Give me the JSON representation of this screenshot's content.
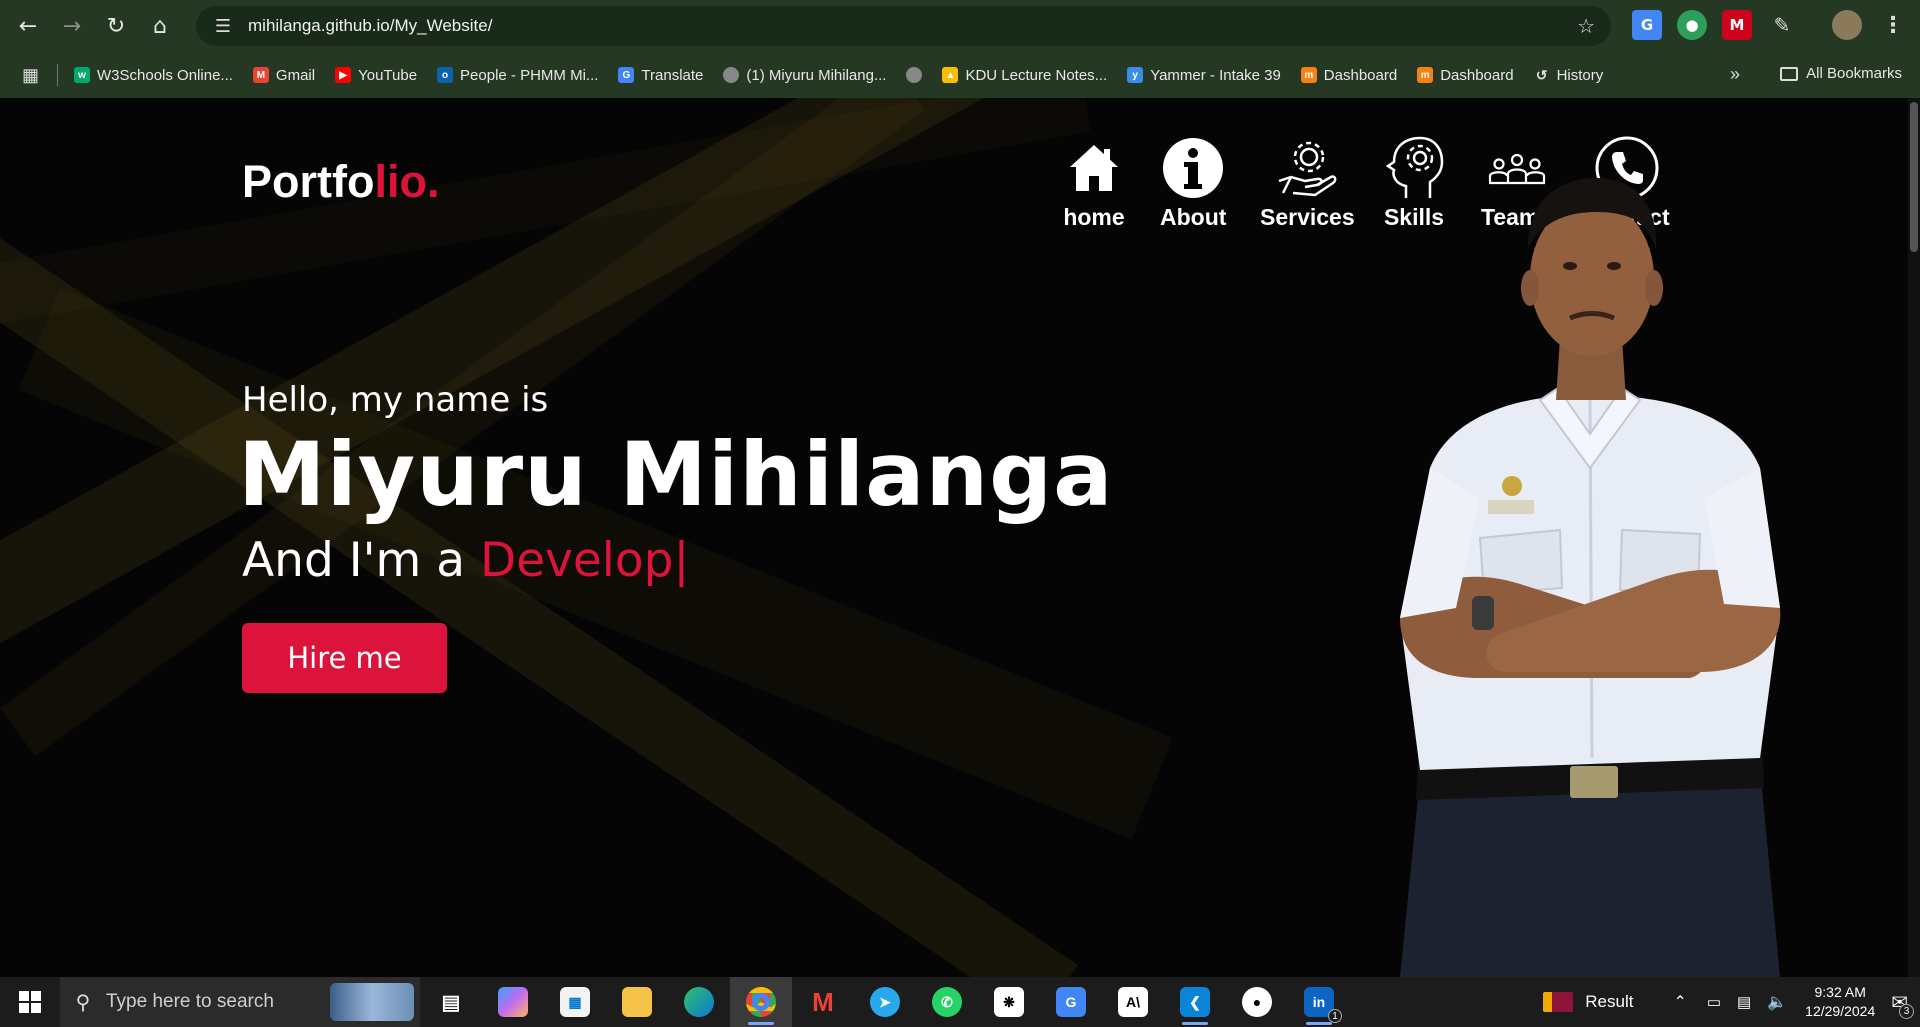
{
  "browser": {
    "url": "mihilanga.github.io/My_Website/",
    "bookmarks": [
      {
        "label": "W3Schools Online...",
        "icon": "w3schools-icon",
        "color": "#04aa6d"
      },
      {
        "label": "Gmail",
        "icon": "gmail-icon",
        "color": "#ea4335"
      },
      {
        "label": "YouTube",
        "icon": "youtube-icon",
        "color": "#ff0000"
      },
      {
        "label": "People - PHMM Mi...",
        "icon": "outlook-icon",
        "color": "#0a64ad"
      },
      {
        "label": "Translate",
        "icon": "translate-icon",
        "color": "#4285f4"
      },
      {
        "label": "(1) Miyuru Mihilang...",
        "icon": "globe-icon",
        "color": "#888888"
      },
      {
        "label": "",
        "icon": "globe-icon",
        "color": "#888888"
      },
      {
        "label": "KDU Lecture Notes...",
        "icon": "drive-icon",
        "color": "#fbbc04"
      },
      {
        "label": "Yammer - Intake 39",
        "icon": "yammer-icon",
        "color": "#3a8ee6"
      },
      {
        "label": "Dashboard",
        "icon": "moodle-icon",
        "color": "#f98012"
      },
      {
        "label": "Dashboard",
        "icon": "moodle-icon",
        "color": "#f98012"
      },
      {
        "label": "History",
        "icon": "history-icon",
        "color": "#555555"
      }
    ],
    "all_bookmarks_label": "All Bookmarks"
  },
  "site": {
    "logo_main": "Portfo",
    "logo_accent": "lio.",
    "nav": [
      {
        "label": "home",
        "icon": "home-icon"
      },
      {
        "label": "About",
        "icon": "info-icon"
      },
      {
        "label": "Services",
        "icon": "service-hand-gear-icon"
      },
      {
        "label": "Skills",
        "icon": "head-gear-icon"
      },
      {
        "label": "Teams",
        "icon": "team-icon"
      },
      {
        "label": "Contact",
        "icon": "phone-icon"
      }
    ],
    "hello": "Hello, my name is",
    "name": "Miyuru Mihilanga",
    "role_prefix": "And I'm a ",
    "role_typed": "Develop|",
    "hire_button": "Hire me",
    "accent_color": "#dc143c"
  },
  "taskbar": {
    "search_placeholder": "Type here to search",
    "result_label": "Result",
    "time": "9:32 AM",
    "date": "12/29/2024",
    "notification_count": "3",
    "linkedin_badge": "1"
  }
}
